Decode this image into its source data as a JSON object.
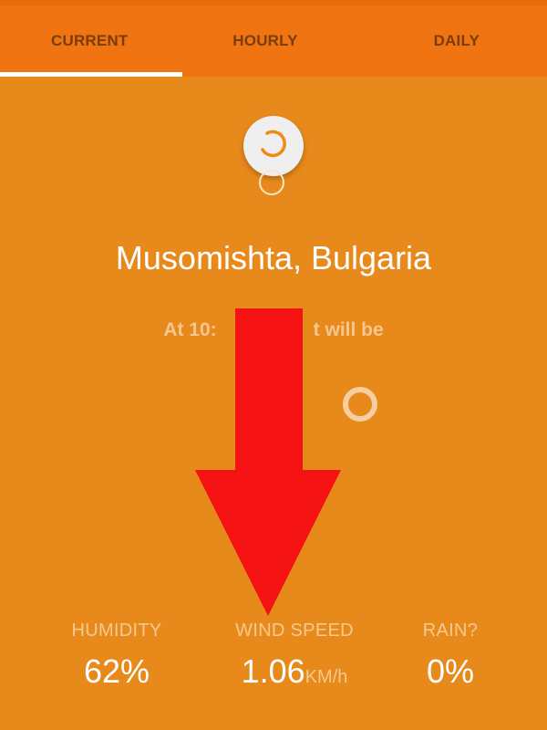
{
  "tabs": [
    {
      "label": "CURRENT",
      "active": true
    },
    {
      "label": "HOURLY",
      "active": false
    },
    {
      "label": "DAILY",
      "active": false
    }
  ],
  "location": "Musomishta, Bulgaria",
  "forecast_prefix": "At 10:",
  "forecast_suffix": "t will be",
  "stats": {
    "humidity": {
      "label": "HUMIDITY",
      "value": "62%"
    },
    "wind": {
      "label": "WIND SPEED",
      "value": "1.06",
      "unit": "KM/h"
    },
    "rain": {
      "label": "RAIN?",
      "value": "0%"
    }
  },
  "colors": {
    "background": "#E8891C",
    "tab_bar": "#F07411",
    "overlay_arrow": "#F41212"
  },
  "icons": {
    "refresh": "refresh-spinner-icon",
    "weather": "weather-loading-icon",
    "arrow": "down-arrow-icon"
  }
}
